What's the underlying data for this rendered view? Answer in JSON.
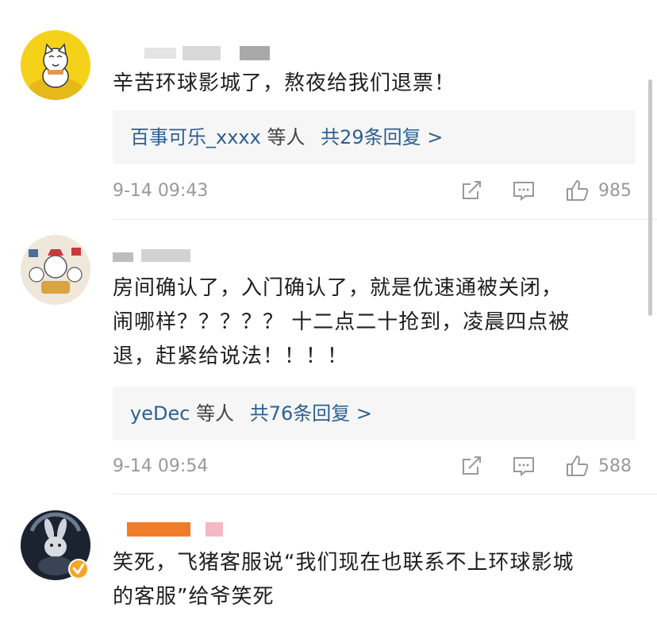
{
  "comments": [
    {
      "username": "",
      "text": "辛苦环球影城了，熬夜给我们退票！",
      "reply_users": "百事可乐_xxxx",
      "reply_others": "等人",
      "reply_count": "共29条回复 >",
      "time": "9-14 09:43",
      "likes": "985"
    },
    {
      "username": "",
      "text": "房间确认了，入门确认了，就是优速通被关闭，\n闹哪样？？？？？ 十二点二十抢到，凌晨四点被\n退，赶紧给说法！！！！",
      "reply_users": "yeDec",
      "reply_others": "等人",
      "reply_count": "共76条回复 >",
      "time": "9-14 09:54",
      "likes": "588"
    },
    {
      "username": "",
      "text": "笑死，飞猪客服说“我们现在也联系不上环球影城\n的客服”给爷笑死"
    }
  ],
  "colors": {
    "link": "#2e5f8f",
    "reply_bg": "#f6f6f7",
    "meta": "#999999",
    "orange_bar": "#f07c2a",
    "pink_bar": "#f4b8c4"
  },
  "icons": [
    "share-icon",
    "comment-icon",
    "like-icon",
    "verified-badge-icon"
  ]
}
